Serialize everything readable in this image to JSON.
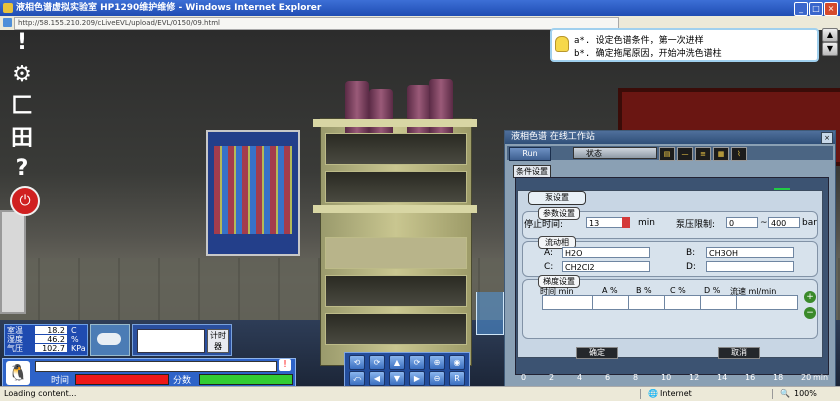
{
  "window": {
    "title": "液相色谱虚拟实验室 HP1290维护维修 - Windows Internet Explorer",
    "address": "http://58.155.210.209/cLiveEVL/upload/EVL/0150/09.html"
  },
  "hint": {
    "line1": "a*. 设定色谱条件，第一次进样",
    "line2": "b*. 确定拖尾原因，开始冲洗色谱柱"
  },
  "workstation": {
    "title": "液相色谱 在线工作站",
    "run_label": "Run",
    "state_label": "状态",
    "condition_tab": "条件设置",
    "axis_ticks": [
      "0",
      "2",
      "4",
      "6",
      "8",
      "10",
      "12",
      "14",
      "16",
      "18",
      "20"
    ],
    "axis_unit": "min"
  },
  "pump_dialog": {
    "title": "泵设置",
    "params_section": "参数设置",
    "stop_time_label": "停止时间:",
    "stop_time_value": "13",
    "stop_time_unit": "min",
    "pressure_limit_label": "泵压限制:",
    "pressure_min": "0",
    "pressure_tilde": "~",
    "pressure_max": "400",
    "pressure_unit": "bar",
    "mobile_phase_section": "流动相",
    "channel_a_label": "A:",
    "channel_a_value": "H2O",
    "channel_b_label": "B:",
    "channel_b_value": "CH3OH",
    "channel_c_label": "C:",
    "channel_c_value": "CH2Cl2",
    "channel_d_label": "D:",
    "channel_d_value": "",
    "gradient_section": "梯度设置",
    "gradient_headers": [
      "时间 min",
      "A %",
      "B %",
      "C %",
      "D %",
      "流速 ml/min"
    ],
    "confirm_label": "确定",
    "cancel_label": "取消"
  },
  "environment": {
    "temp_label": "室温",
    "temp_value": "18.2",
    "temp_unit": "C",
    "humidity_label": "湿度",
    "humidity_value": "46.2",
    "humidity_unit": "%",
    "pressure_label": "气压",
    "pressure_value": "102.7",
    "pressure_unit": "KPa"
  },
  "timer": {
    "button_label": "计时器"
  },
  "hud": {
    "time_label": "时间",
    "score_label": "分数",
    "time_fill": 1.0,
    "score_fill": 1.0
  },
  "camera_controls": [
    "⟲",
    "⟳",
    "▲",
    "⟳",
    "⊕",
    "◉",
    "⤺",
    "◀",
    "▼",
    "▶",
    "⊖",
    "R"
  ],
  "status_bar": {
    "loading": "Loading content...",
    "zone": "Internet",
    "zoom": "100%"
  },
  "colors": {
    "ie_title": "#2a5bc4",
    "ws_title": "#3f5f8a",
    "time_bar": "#ee1818",
    "score_bar": "#33cc33"
  }
}
